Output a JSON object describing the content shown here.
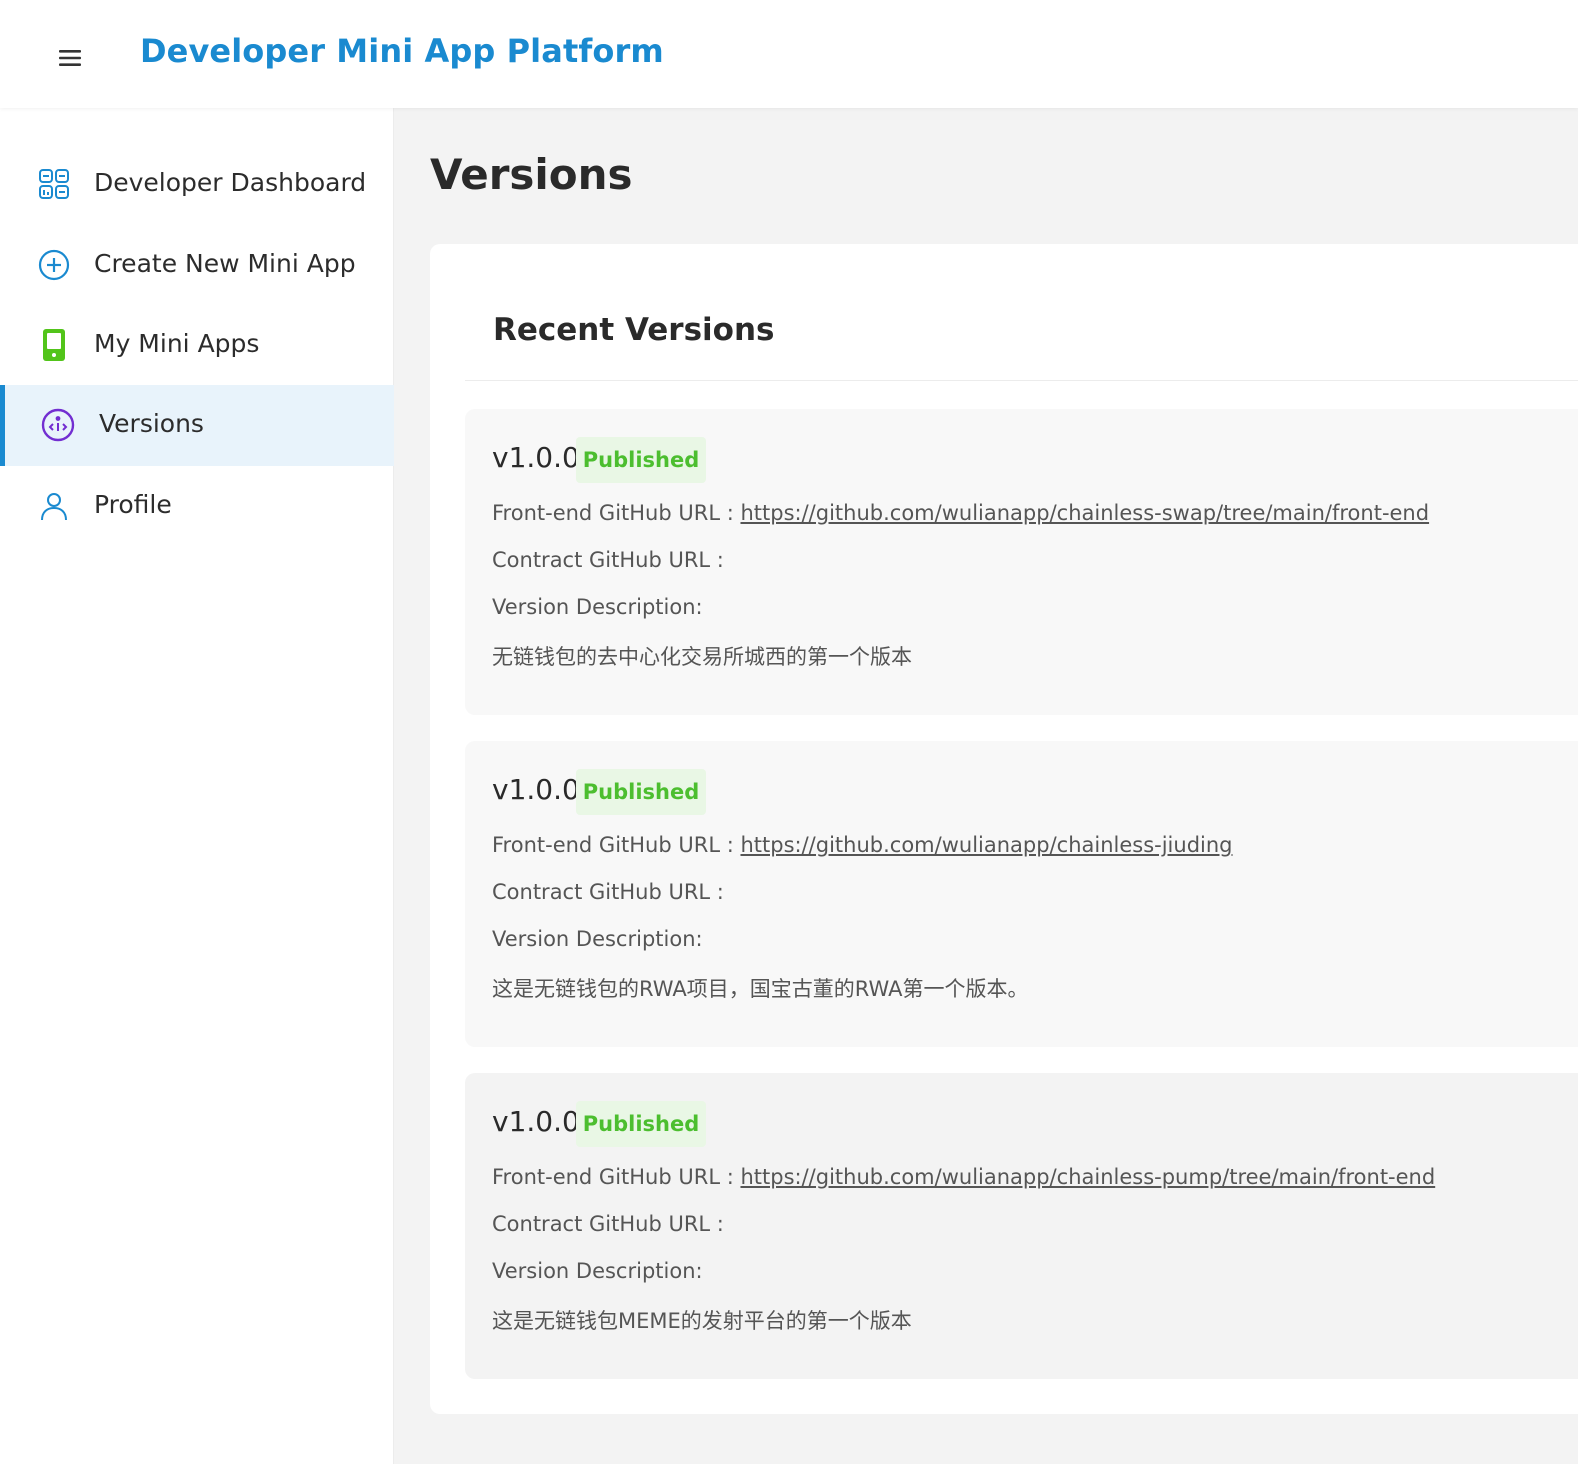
{
  "header": {
    "title": "Developer Mini App Platform",
    "menu_icon": "hamburger-icon",
    "title_color": "#1a8ad0"
  },
  "sidebar": {
    "items": [
      {
        "label": "Developer Dashboard",
        "icon": "dashboard-grid-icon",
        "active": false
      },
      {
        "label": "Create New Mini App",
        "icon": "plus-circle-icon",
        "active": false
      },
      {
        "label": "My Mini Apps",
        "icon": "phone-app-icon",
        "active": false
      },
      {
        "label": "Versions",
        "icon": "code-version-icon",
        "active": true
      },
      {
        "label": "Profile",
        "icon": "user-icon",
        "active": false
      }
    ]
  },
  "main": {
    "page_title": "Versions",
    "card_title": "Recent Versions",
    "front_end_label": "Front-end GitHub URL :",
    "contract_label": "Contract GitHub URL :",
    "description_label": "Version Description:",
    "versions": [
      {
        "version": "v1.0.0",
        "status": "Published",
        "front_end_url": "https://github.com/wulianapp/chainless-swap/tree/main/front-end",
        "contract_url": "",
        "description": "无链钱包的去中心化交易所城西的第一个版本"
      },
      {
        "version": "v1.0.0",
        "status": "Published",
        "front_end_url": "https://github.com/wulianapp/chainless-jiuding",
        "contract_url": "",
        "description": "这是无链钱包的RWA项目，国宝古董的RWA第一个版本。"
      },
      {
        "version": "v1.0.0",
        "status": "Published",
        "front_end_url": "https://github.com/wulianapp/chainless-pump/tree/main/front-end",
        "contract_url": "",
        "description": "这是无链钱包MEME的发射平台的第一个版本"
      }
    ]
  },
  "colors": {
    "accent": "#1a8ad0",
    "published_text": "#4cbe2f",
    "published_bg": "#e9f7e5",
    "active_nav_bg": "#e8f3fb"
  }
}
